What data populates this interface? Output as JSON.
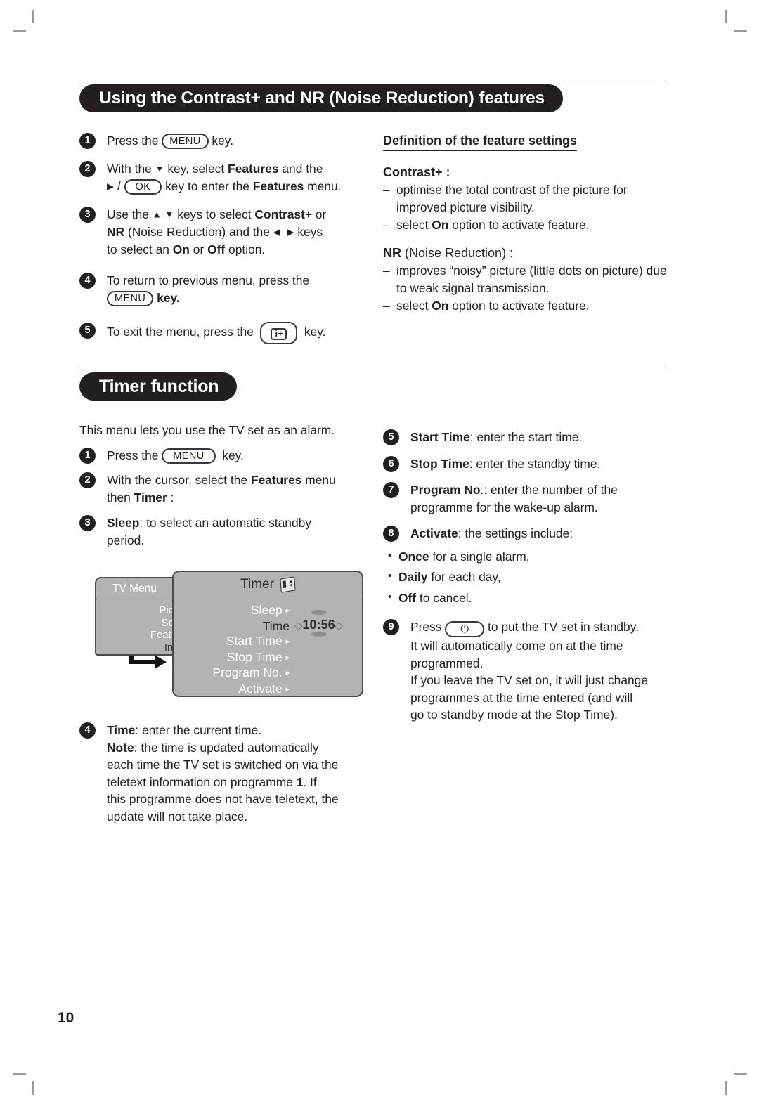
{
  "page": {
    "number": "10"
  },
  "section1": {
    "title": "Using the Contrast+ and NR (Noise Reduction) features",
    "steps": [
      {
        "num": "1",
        "html": "Press the <span class=\"key\" data-name=\"menu-key-glyph\" data-interactable=\"false\">MENU</span> key."
      },
      {
        "num": "2",
        "html": "With the <span class=\"arrow-g\">▼</span> key, select <b>Features</b> and the<br><span class=\"arrow-g\">▶</span> / <span class=\"key wide\" data-name=\"ok-key-glyph\" data-interactable=\"false\">OK</span> key to enter the <b>Features</b> menu."
      },
      {
        "num": "3",
        "html": "Use the <span class=\"arrow-g\">▲</span> <span class=\"arrow-g\">▼</span> keys to select <b>Contrast+</b> or<br><b>NR</b> (Noise Reduction) and the <span class=\"arrow-g\">◀</span>&nbsp; <span class=\"arrow-g\">▶</span> keys<br>to select an <b>On</b> or <b>Off</b> option."
      },
      {
        "num": "4",
        "html": "To return to previous menu, press the<br><span class=\"key\" data-name=\"menu-key-glyph\" data-interactable=\"false\">MENU</span> <b>key.</b>"
      },
      {
        "num": "5",
        "html": "To exit the menu, press the &nbsp;<span class=\"key-info\" data-name=\"info-key-glyph\" data-interactable=\"false\"><span class=\"inner\">i+</span></span> &nbsp;key."
      }
    ],
    "definition": {
      "title": "Definition of the feature settings",
      "contrast_heading": "Contrast+ :",
      "contrast_items": [
        "optimise the total contrast of the picture for improved picture visibility.",
        "select On option to activate feature."
      ],
      "nr_heading_bold": "NR",
      "nr_heading_rest": " (Noise Reduction) :",
      "nr_items": [
        "improves “noisy” picture (little dots on picture) due to weak signal transmission.",
        "select On option to activate feature."
      ]
    }
  },
  "section2": {
    "title": "Timer function",
    "intro": "This menu lets you use the TV set as an alarm.",
    "steps_left": [
      {
        "num": "1",
        "html": "Press the <span class=\"key wide\" data-name=\"menu-key-glyph\" data-interactable=\"false\">MENU</span> &nbsp;key."
      },
      {
        "num": "2",
        "html": "With the cursor, select the <b>Features</b> menu<br>then <b>Timer</b> :"
      },
      {
        "num": "3",
        "html": "<b>Sleep</b>: to select an automatic standby<br>period."
      }
    ],
    "steps_left_after": [
      {
        "num": "4",
        "html": "<b>Time</b>: enter the current time.<br><b>Note</b>: the time is updated automatically<br>each time the TV set is switched on via the<br>teletext information on programme <b>1</b>. If<br>this programme does not have teletext, the<br>update will not take place."
      }
    ],
    "steps_right": [
      {
        "num": "5",
        "html": "<b>Start Time</b>: enter the start time."
      },
      {
        "num": "6",
        "html": "<b>Stop Time</b>: enter the standby time."
      },
      {
        "num": "7",
        "html": "<b>Program No</b>.: enter the number of the<br>programme for the wake-up alarm."
      },
      {
        "num": "8",
        "html": "<b>Activate</b>: the settings include:"
      }
    ],
    "activate_options": [
      {
        "bold": "Once",
        "rest": " for a single alarm,"
      },
      {
        "bold": "Daily",
        "rest": " for each day,"
      },
      {
        "bold": "Off",
        "rest": " to cancel."
      }
    ],
    "step9": {
      "num": "9",
      "html": "Press <span class=\"key-power\" data-name=\"standby-key-glyph\" data-interactable=\"false\">⏻</span> to put the TV set in standby.<br>It will automatically come on at the time<br>programmed.<br>If you leave the TV set on, it will just change<br>programmes at the time entered (and will<br>go to standby mode at the Stop Time)."
    },
    "tv_menu": {
      "base_title": "TV Menu",
      "base_items": [
        "Picture",
        "Sound",
        "Features",
        "Install"
      ],
      "base_selected": "Install",
      "front_title": "Timer",
      "front_icon": "timer-card-icon",
      "front_rows": [
        {
          "label": "Sleep",
          "arrow": "▸",
          "dark": false
        },
        {
          "label": "Time",
          "arrow": "",
          "dark": true
        },
        {
          "label": "Start Time",
          "arrow": "▸",
          "dark": false
        },
        {
          "label": "Stop Time",
          "arrow": "▸",
          "dark": false
        },
        {
          "label": "Program No.",
          "arrow": "▸",
          "dark": false
        },
        {
          "label": "Activate",
          "arrow": "▸",
          "dark": false
        }
      ],
      "time_value": "10:56",
      "left_chevron": "◇",
      "right_chevron": "◇"
    }
  }
}
